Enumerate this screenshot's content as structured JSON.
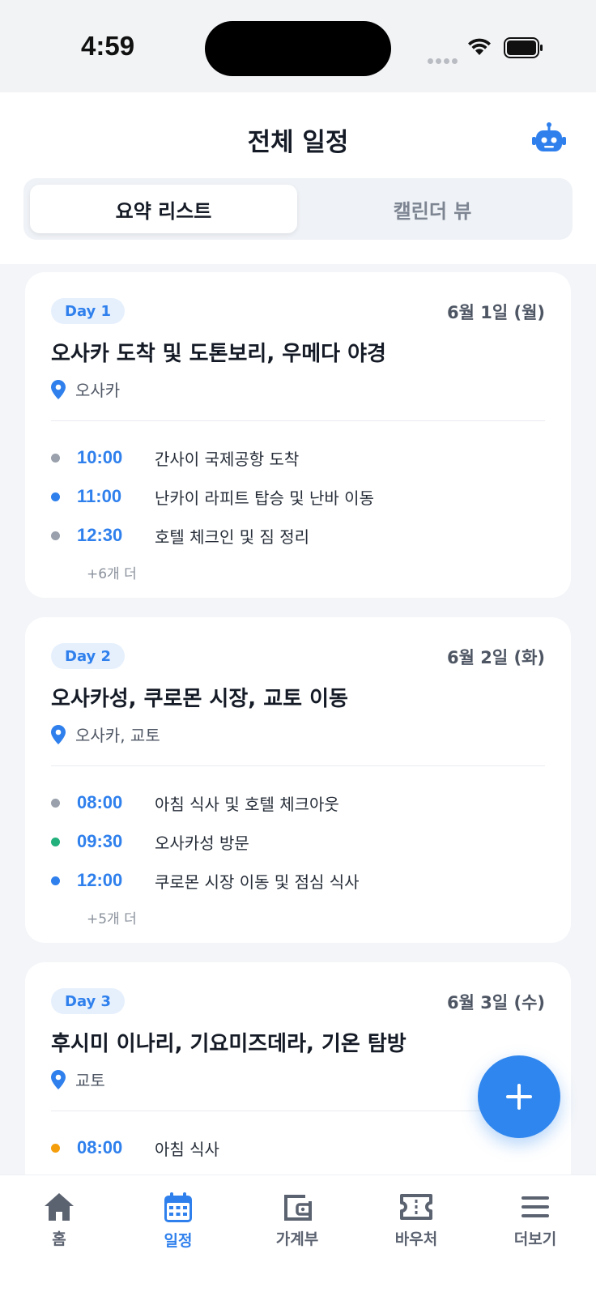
{
  "status_bar": {
    "time": "4:59"
  },
  "header": {
    "title": "전체 일정",
    "tabs": [
      {
        "label": "요약 리스트",
        "active": true
      },
      {
        "label": "캘린더 뷰",
        "active": false
      }
    ]
  },
  "days": [
    {
      "badge": "Day 1",
      "date": "6월 1일 (월)",
      "title": "오사카 도착 및 도톤보리, 우메다 야경",
      "location": "오사카",
      "events": [
        {
          "time": "10:00",
          "title": "간사이 국제공항 도착",
          "dot_color": "#9aa1ac"
        },
        {
          "time": "11:00",
          "title": "난카이 라피트 탑승 및 난바 이동",
          "dot_color": "#2f80ed"
        },
        {
          "time": "12:30",
          "title": "호텔 체크인 및 짐 정리",
          "dot_color": "#9aa1ac"
        }
      ],
      "more": "+6개 더"
    },
    {
      "badge": "Day 2",
      "date": "6월 2일 (화)",
      "title": "오사카성, 쿠로몬 시장, 교토 이동",
      "location": "오사카, 교토",
      "events": [
        {
          "time": "08:00",
          "title": "아침 식사 및 호텔 체크아웃",
          "dot_color": "#9aa1ac"
        },
        {
          "time": "09:30",
          "title": "오사카성 방문",
          "dot_color": "#22b07d"
        },
        {
          "time": "12:00",
          "title": "쿠로몬 시장 이동 및 점심 식사",
          "dot_color": "#2f80ed"
        }
      ],
      "more": "+5개 더"
    },
    {
      "badge": "Day 3",
      "date": "6월 3일 (수)",
      "title": "후시미 이나리, 기요미즈데라, 기온 탐방",
      "location": "교토",
      "events": [
        {
          "time": "08:00",
          "title": "아침 식사",
          "dot_color": "#f59e0b"
        }
      ]
    }
  ],
  "fab": {
    "icon": "plus-icon"
  },
  "bottom_nav": [
    {
      "label": "홈",
      "icon": "home-icon",
      "active": false
    },
    {
      "label": "일정",
      "icon": "calendar-icon",
      "active": true
    },
    {
      "label": "가계부",
      "icon": "wallet-icon",
      "active": false
    },
    {
      "label": "바우처",
      "icon": "ticket-icon",
      "active": false
    },
    {
      "label": "더보기",
      "icon": "menu-icon",
      "active": false
    }
  ],
  "colors": {
    "accent": "#2f80ed",
    "badge_bg": "#e6f0fd"
  }
}
